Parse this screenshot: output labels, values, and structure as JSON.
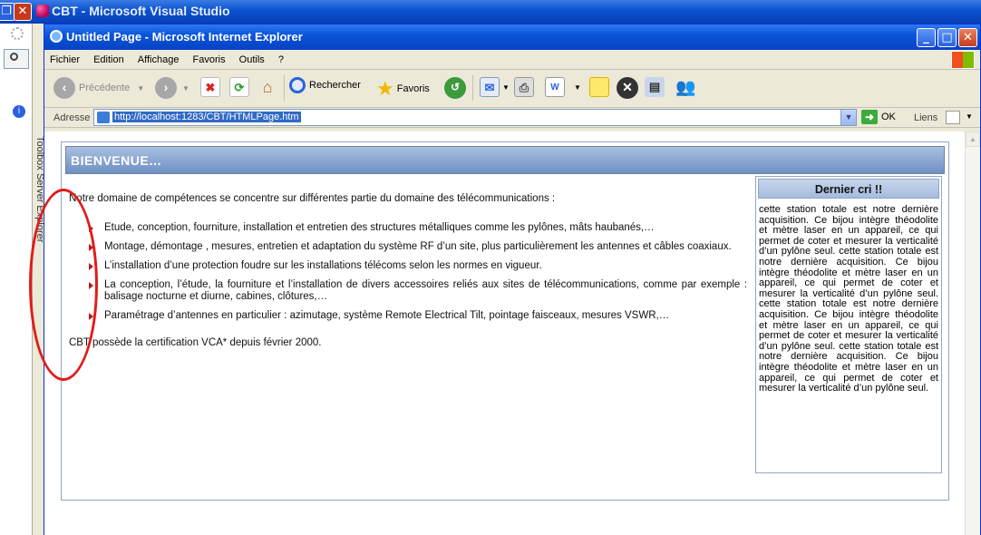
{
  "vs": {
    "title": "CBT - Microsoft Visual Studio",
    "side_label": "Toolbox  Server Explorer"
  },
  "ie": {
    "title": "Untitled Page - Microsoft Internet Explorer",
    "menu": [
      "Fichier",
      "Edition",
      "Affichage",
      "Favoris",
      "Outils",
      "?"
    ],
    "toolbar": {
      "back": "Précédente",
      "search": "Rechercher",
      "favorites": "Favoris"
    },
    "address": {
      "label": "Adresse",
      "url": "http://localhost:1283/CBT/HTMLPage.htm",
      "go": "OK",
      "links": "Liens"
    }
  },
  "page": {
    "header": "BIENVENUE…",
    "intro": "Notre domaine de compétences se concentre sur différentes partie du domaine des télécommunications :",
    "services": [
      "Etude, conception, fourniture, installation et entretien des structures métalliques comme les pylônes, mâts haubanés,…",
      "Montage, démontage , mesures, entretien et adaptation du système RF d’un site, plus particulièrement les antennes et câbles coaxiaux.",
      "L’installation d’une protection foudre sur les installations télécoms selon les normes en vigueur.",
      "La conception, l’étude, la fourniture et l’installation de divers accessoires reliés aux sites de télécommunications, comme par exemple : balisage nocturne et diurne, cabines, clôtures,…",
      "Paramétrage d’antennes en particulier : azimutage, système Remote Electrical Tilt, pointage faisceaux, mesures VSWR,…"
    ],
    "certification": "CBT possède la certification VCA* depuis février 2000.",
    "sidebox": {
      "title": "Dernier cri !!",
      "body": "cette station totale est notre dernière acquisition. Ce bijou intègre théodolite et mètre laser en un appareil, ce qui permet de coter et mesurer la verticalité d’un pylône seul. cette station totale est notre dernière acquisition. Ce bijou intègre théodolite et mètre laser en un appareil, ce qui permet de coter et mesurer la verticalité d’un pylône seul. cette station totale est notre dernière acquisition. Ce bijou intègre théodolite et mètre laser en un appareil, ce qui permet de coter et mesurer la verticalité d’un pylône seul. cette station totale est notre dernière acquisition. Ce bijou intègre théodolite et mètre laser en un appareil, ce qui permet de coter et mesurer la verticalité d’un pylône seul."
    }
  },
  "annotation": {
    "color": "#e21b1b"
  }
}
